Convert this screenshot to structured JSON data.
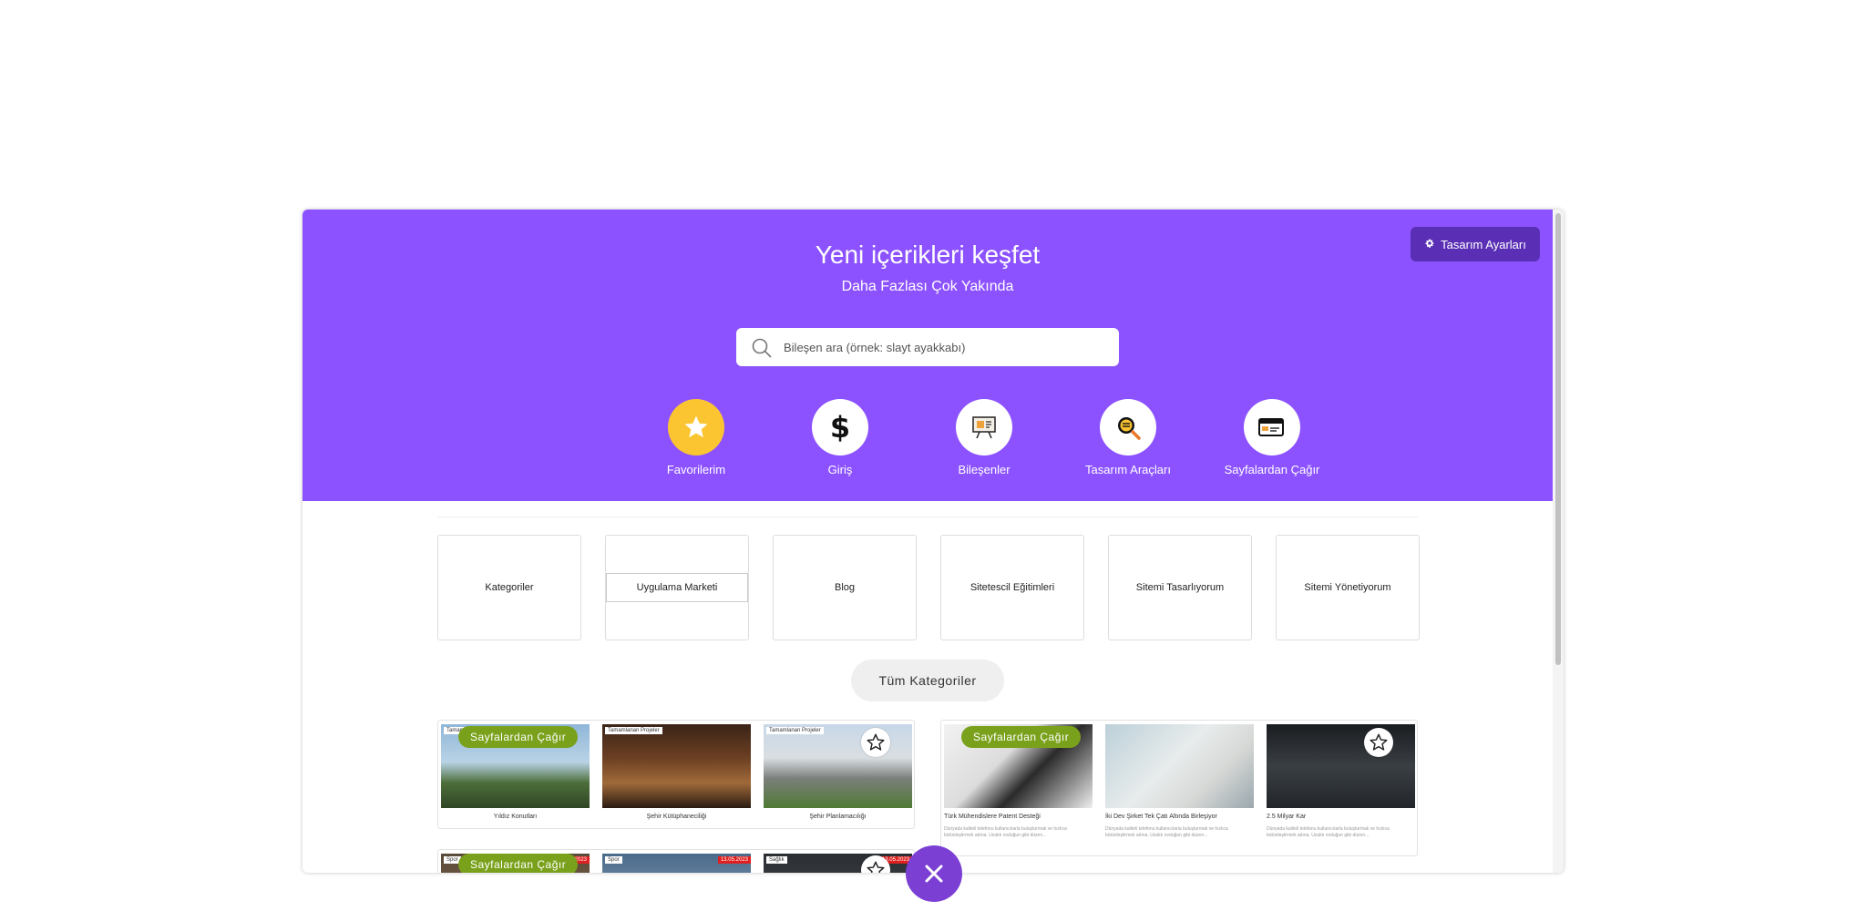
{
  "hero": {
    "title": "Yeni içerikleri keşfet",
    "subtitle": "Daha Fazlası Çok Yakında",
    "settings_label": "Tasarım Ayarları",
    "search_placeholder": "Bileşen ara (örnek: slayt ayakkabı)"
  },
  "nav": [
    {
      "label": "Favorilerim",
      "icon": "star-icon"
    },
    {
      "label": "Giriş",
      "icon": "dollar-icon"
    },
    {
      "label": "Bileşenler",
      "icon": "presentation-board-icon"
    },
    {
      "label": "Tasarım Araçları",
      "icon": "magnifier-icon"
    },
    {
      "label": "Sayfalardan Çağır",
      "icon": "card-icon"
    }
  ],
  "categories": [
    "Kategoriler",
    "Uygulama Marketi",
    "Blog",
    "Sitetescil Eğitimleri",
    "Sitemi Tasarlıyorum",
    "Sitemi Yönetiyorum"
  ],
  "all_categories_label": "Tüm Kategoriler",
  "badge_label": "Sayfalardan Çağır",
  "card1": {
    "tags": [
      "Tamamlanan Projeler",
      "Tamamlanan Projeler",
      "Tamamlanan Projeler"
    ],
    "captions": [
      "Yıldız Konutları",
      "Şehir Kütüphaneciliği",
      "Şehir Planlamacılığı"
    ]
  },
  "card2": {
    "captions": [
      "Türk Mühendislere Patent Desteği",
      "İki Dev Şirket Tek Çatı Altında Birleşiyor",
      "2.5 Milyar Kar"
    ],
    "descriptions": [
      "Dünyada kaliteli telefonu kullanıcılarla buluşturmak ve hızlıca bütünleştirmek adına. Uzaktı ovduğun gibi düzen...",
      "Dünyada kaliteli telefonu kullanıcılarla buluşturmak ve hızlıca bütünleştirmek adına. Uzaktı ovduğun gibi düzen...",
      "Dünyada kaliteli telefonu kullanıcılarla buluşturmak ve hızlıca bütünleştirmek adına. Uzaktı ovduğun gibi düzen..."
    ]
  },
  "card3": {
    "tags": [
      "Spor",
      "Spor",
      "Sağlık"
    ],
    "dates": [
      "13.05.2023",
      "13.05.2023",
      "13.05.2023"
    ]
  },
  "colors": {
    "hero": "#8c52ff",
    "settings": "#5a2fb5",
    "badge": "#7aa11b",
    "favorite": "#fbc531",
    "close": "#7b3fd4"
  }
}
